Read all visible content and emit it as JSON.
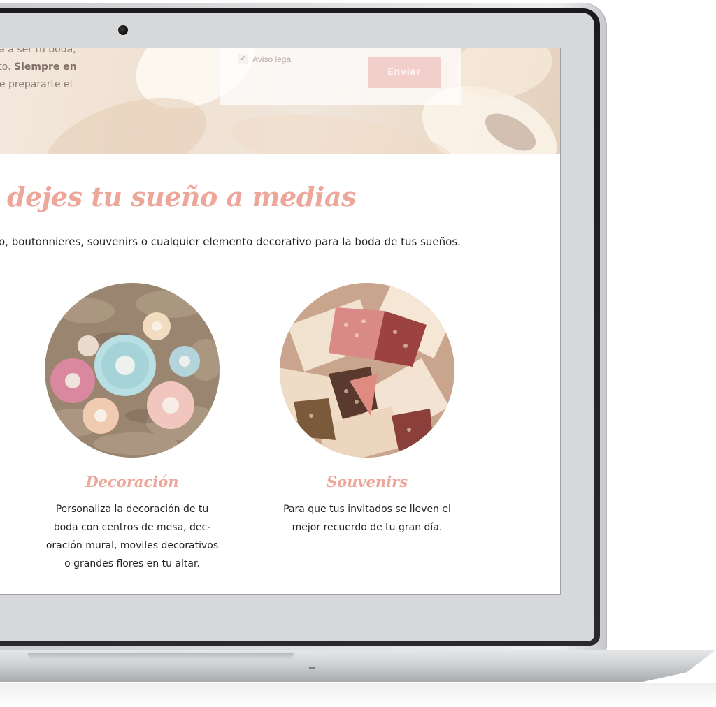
{
  "hero": {
    "text_lines": [
      {
        "plain": "va a ser tu boda,",
        "bold": ""
      },
      {
        "plain": "sto. ",
        "bold": "Siempre en"
      },
      {
        "plain": "de prepararte el",
        "bold": ""
      }
    ],
    "form": {
      "legal_label": "Aviso legal",
      "legal_checked": true,
      "submit_label": "Enviar"
    }
  },
  "section": {
    "title": "dejes tu sueño a medias",
    "lead": "o, boutonnieres, souvenirs o cualquier elemento decorativo para la boda de tus sueños."
  },
  "cards": [
    {
      "title": "Decoración",
      "text_lines": [
        "Personaliza la decoración de tu",
        "boda con centros de mesa, dec-",
        "oración mural, moviles decorativos",
        "o grandes flores en tu altar."
      ]
    },
    {
      "title": "Souvenirs",
      "text_lines": [
        "Para que tus invitados se lleven el",
        "mejor recuerdo de tu gran día."
      ]
    }
  ],
  "colors": {
    "accent": "#eda69a",
    "button": "#f3cfcb",
    "body_text": "#222222"
  }
}
